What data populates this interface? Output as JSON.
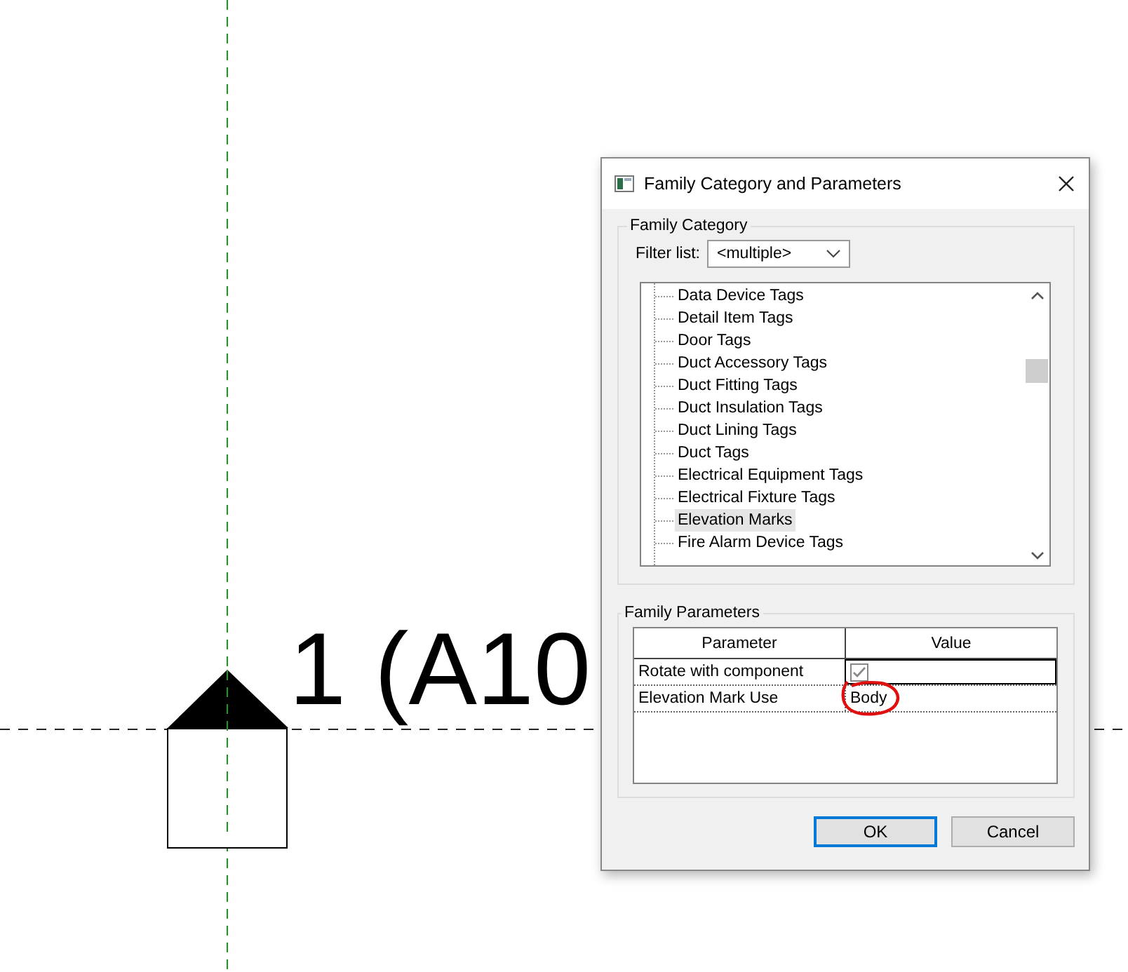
{
  "canvas": {
    "label": "1 (A10"
  },
  "dialog": {
    "title": "Family Category and Parameters",
    "family_category": {
      "heading": "Family Category",
      "filter_label": "Filter list:",
      "filter_value": "<multiple>",
      "items": [
        {
          "label": "Data Device Tags",
          "selected": false
        },
        {
          "label": "Detail Item Tags",
          "selected": false
        },
        {
          "label": "Door Tags",
          "selected": false
        },
        {
          "label": "Duct Accessory Tags",
          "selected": false
        },
        {
          "label": "Duct Fitting Tags",
          "selected": false
        },
        {
          "label": "Duct Insulation Tags",
          "selected": false
        },
        {
          "label": "Duct Lining Tags",
          "selected": false
        },
        {
          "label": "Duct Tags",
          "selected": false
        },
        {
          "label": "Electrical Equipment Tags",
          "selected": false
        },
        {
          "label": "Electrical Fixture Tags",
          "selected": false
        },
        {
          "label": "Elevation Marks",
          "selected": true
        },
        {
          "label": "Fire Alarm Device Tags",
          "selected": false
        }
      ]
    },
    "family_parameters": {
      "heading": "Family Parameters",
      "columns": [
        "Parameter",
        "Value"
      ],
      "rows": [
        {
          "name": "Rotate with component",
          "kind": "checkbox",
          "checked": true
        },
        {
          "name": "Elevation Mark Use",
          "kind": "text",
          "value": "Body"
        }
      ]
    },
    "buttons": [
      {
        "label": "OK",
        "default": true
      },
      {
        "label": "Cancel",
        "default": false
      }
    ]
  }
}
